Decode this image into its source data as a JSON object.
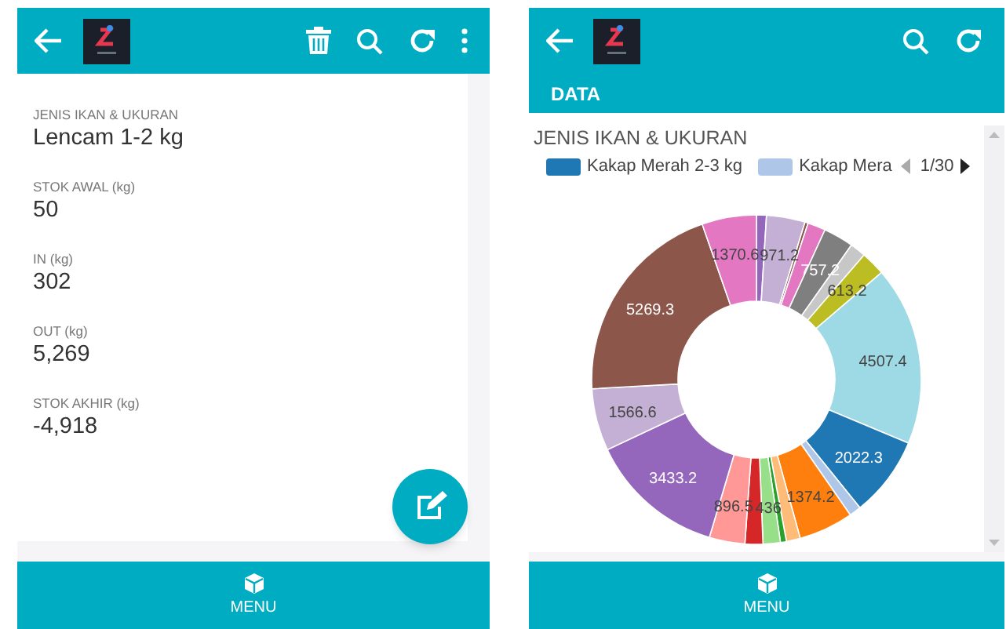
{
  "detail_screen": {
    "toolbar": {
      "actions": [
        {
          "kind": "delete"
        },
        {
          "kind": "search"
        },
        {
          "kind": "refresh"
        },
        {
          "kind": "more"
        }
      ]
    },
    "fields": [
      {
        "label": "JENIS IKAN & UKURAN",
        "value": "Lencam 1-2 kg"
      },
      {
        "label": "STOK AWAL (kg)",
        "value": "50"
      },
      {
        "label": "IN (kg)",
        "value": "302"
      },
      {
        "label": "OUT (kg)",
        "value": "5,269"
      },
      {
        "label": "STOK AKHIR (kg)",
        "value": "-4,918"
      }
    ],
    "bottom_bar": {
      "label": "MENU"
    }
  },
  "chart_screen": {
    "toolbar": {
      "actions": [
        {
          "kind": "search"
        },
        {
          "kind": "refresh"
        }
      ]
    },
    "tab": {
      "label": "DATA"
    },
    "chart_title": "JENIS IKAN & UKURAN",
    "legend": {
      "items": [
        {
          "label": "Kakap Merah 2-3 kg",
          "color": "#1f77b4"
        },
        {
          "label": "Kakap Mera",
          "color": "#aec7e8"
        }
      ],
      "page": "1/30"
    },
    "chart_data": {
      "type": "donut",
      "values": [
        250,
        971.2,
        80,
        450,
        757.2,
        400,
        613.2,
        4507.4,
        2022.3,
        300,
        1374.2,
        350,
        150,
        436,
        450,
        896.5,
        3433.2,
        1566.6,
        5269.3,
        1370.6
      ],
      "colors": [
        "#9467bd",
        "#c5b0d5",
        "#8c564b",
        "#e377c2",
        "#7f7f7f",
        "#c7c7c7",
        "#bcbd22",
        "#9edae5",
        "#1f77b4",
        "#aec7e8",
        "#ff7f0e",
        "#ffbb78",
        "#2ca02c",
        "#98df8a",
        "#d62728",
        "#ff9896",
        "#9467bd",
        "#c5b0d5",
        "#8c564b",
        "#e377c2"
      ],
      "value_labels": [
        null,
        "971.2",
        null,
        null,
        "757.2",
        null,
        "613.2",
        "4507.4",
        "2022.3",
        null,
        "1374.2",
        null,
        null,
        "436",
        null,
        "896.5",
        "3433.2",
        "1566.6",
        "5269.3",
        "1370.6"
      ]
    },
    "bottom_bar": {
      "label": "MENU"
    }
  }
}
